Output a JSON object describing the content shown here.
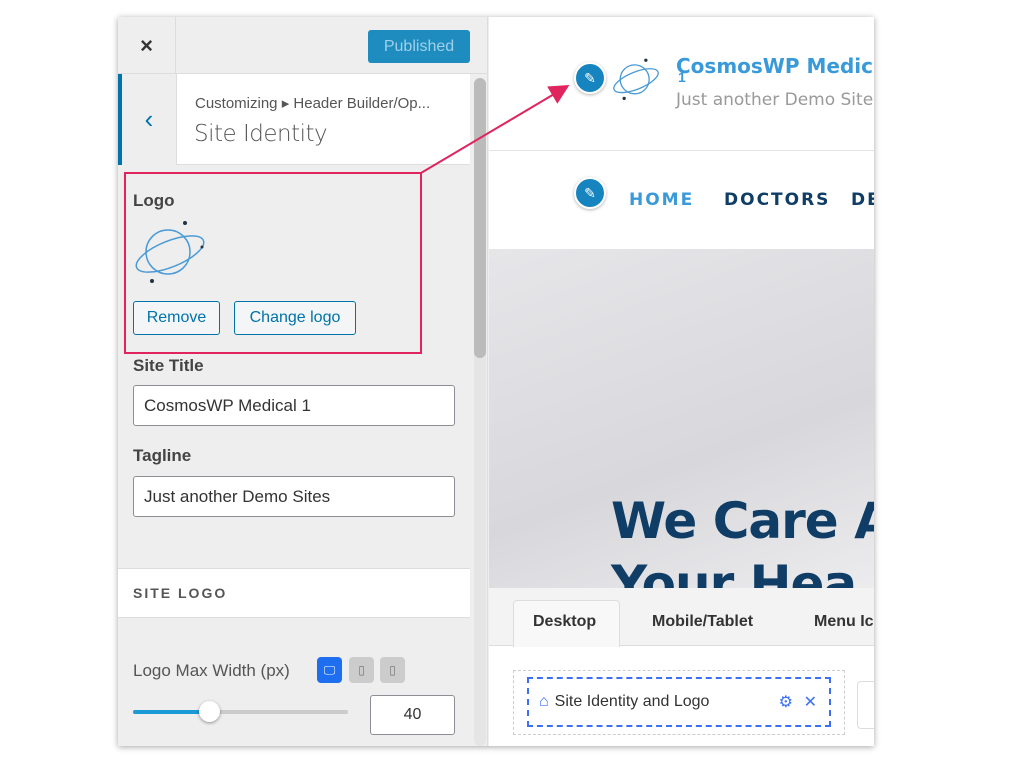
{
  "sidebar": {
    "close_label": "×",
    "publish_button": "Published",
    "breadcrumb": "Customizing ▸ Header Builder/Op...",
    "section_title": "Site Identity",
    "logo_label": "Logo",
    "remove_button": "Remove",
    "change_logo_button": "Change logo",
    "site_title_label": "Site Title",
    "site_title_value": "CosmosWP Medical 1",
    "tagline_label": "Tagline",
    "tagline_value": "Just another Demo Sites",
    "site_logo_section": "SITE LOGO",
    "logo_max_width_label": "Logo Max Width (px)",
    "logo_max_width_value": "40",
    "slider_percent": 35,
    "active_device": "desktop"
  },
  "preview": {
    "site_title": "CosmosWP Medical",
    "site_title_wrap": "1",
    "tagline": "Just another Demo Sites",
    "nav": [
      "HOME",
      "DOCTORS",
      "DE"
    ],
    "hero_line1": "We Care A",
    "hero_line2": "Your Hea",
    "builder_tabs": [
      "Desktop",
      "Mobile/Tablet",
      "Menu Ic"
    ],
    "builder_item": "Site Identity and Logo"
  },
  "colors": {
    "accent": "#0073aa",
    "highlight": "#e0245e",
    "nav_active": "#3a9ad9",
    "nav": "#0f3d66"
  }
}
